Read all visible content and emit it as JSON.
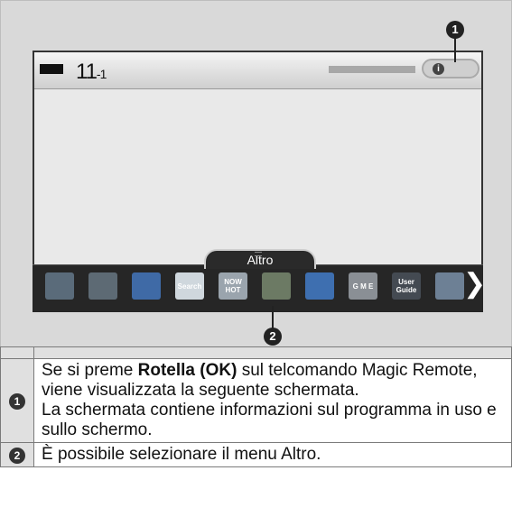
{
  "screen": {
    "channel_number": "11",
    "channel_sub": "-1",
    "info_icon_glyph": "i",
    "menu_tab_label": "Altro"
  },
  "launcher": {
    "items": [
      {
        "name": "tv-remote-icon",
        "label": "",
        "color": "#5a6b7a"
      },
      {
        "name": "settings-gear-icon",
        "label": "",
        "color": "#5d6a74"
      },
      {
        "name": "globe-icon",
        "label": "",
        "color": "#3f6aa6"
      },
      {
        "name": "search-icon",
        "label": "Search",
        "color": "#cfd7dd"
      },
      {
        "name": "now-hot-icon",
        "label": "NOW HOT",
        "color": "#9aa4ad"
      },
      {
        "name": "smart-share-icon",
        "label": "",
        "color": "#6c7a64"
      },
      {
        "name": "clock-icon",
        "label": "",
        "color": "#3e6fb0"
      },
      {
        "name": "game-icon",
        "label": "G M E",
        "color": "#8a8f95"
      },
      {
        "name": "user-guide-icon",
        "label": "User Guide",
        "color": "#444a52"
      },
      {
        "name": "app-store-icon",
        "label": "",
        "color": "#6d8095"
      }
    ]
  },
  "callouts": {
    "one": "1",
    "two": "2"
  },
  "legend": {
    "row1_text_a": "Se si preme ",
    "row1_bold": "Rotella (OK)",
    "row1_text_b": " sul telcomando Magic Remote, viene visualizzata la seguente schermata.",
    "row1_text_c": "La schermata contiene informazioni sul programma in uso e sullo schermo.",
    "row2_text": "È possibile selezionare il menu Altro."
  }
}
